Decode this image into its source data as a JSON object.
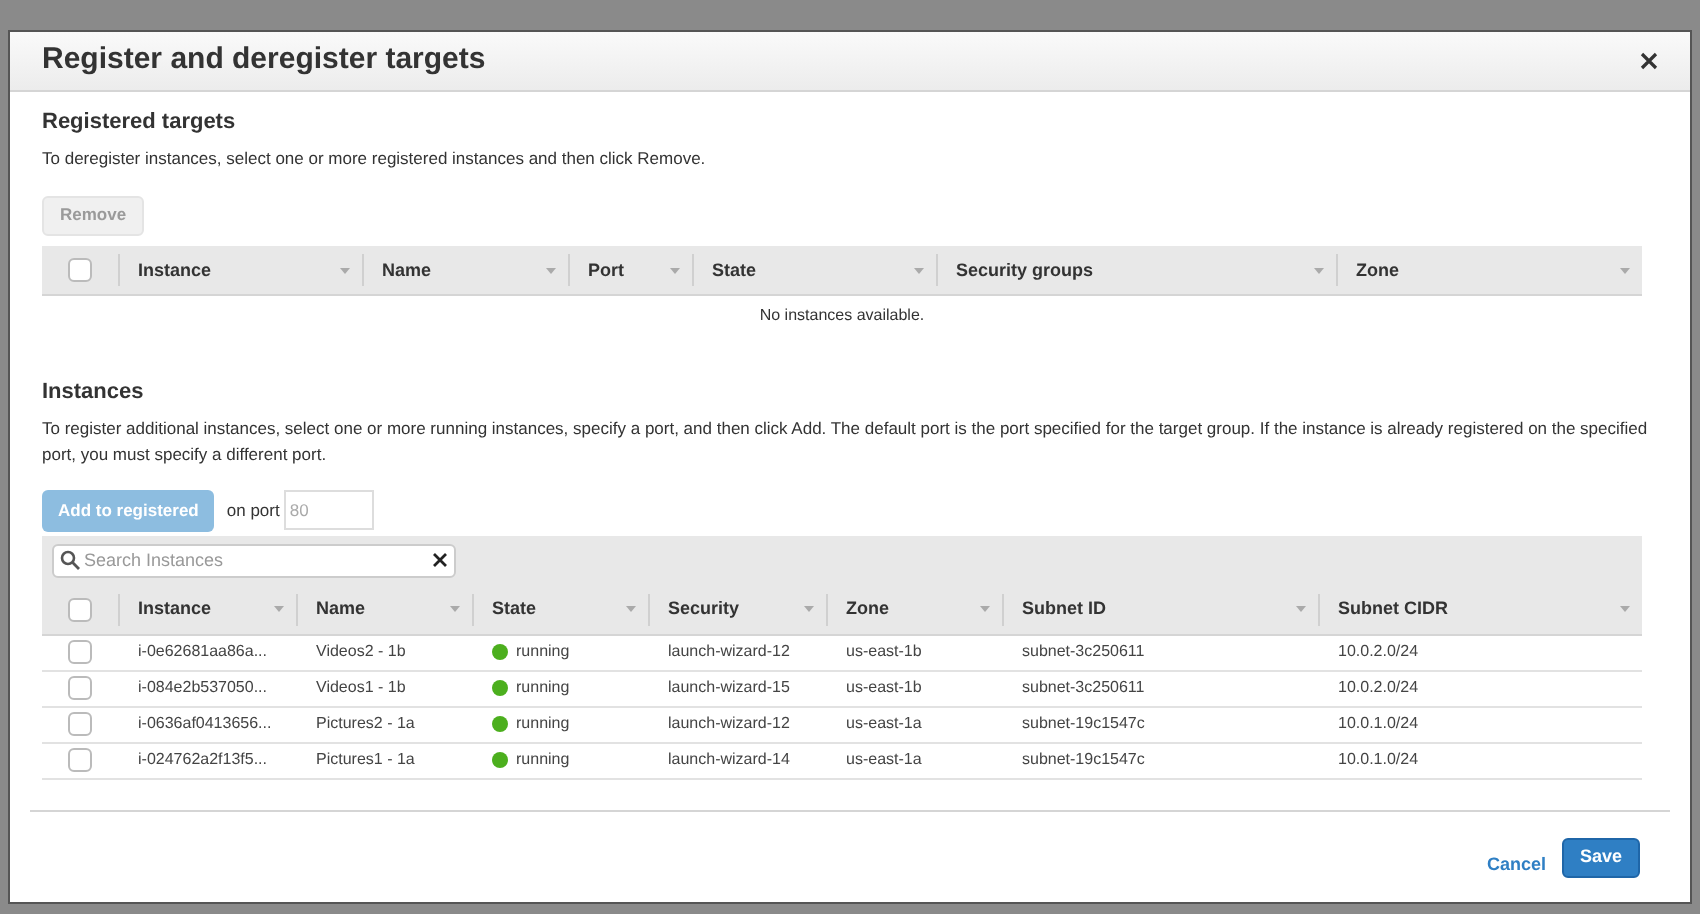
{
  "dialog": {
    "title": "Register and deregister targets"
  },
  "registered": {
    "heading": "Registered targets",
    "description": "To deregister instances, select one or more registered instances and then click Remove.",
    "remove_button": {
      "label": "Remove",
      "disabled": true
    },
    "select_all_checked": false,
    "columns": [
      "Instance",
      "Name",
      "Port",
      "State",
      "Security groups",
      "Zone"
    ],
    "empty_message": "No instances available."
  },
  "instances": {
    "heading": "Instances",
    "description": "To register additional instances, select one or more running instances, specify a port, and then click Add. The default port is the port specified for the target group. If the instance is already registered on the specified port, you must specify a different port.",
    "add_button": {
      "label": "Add to registered",
      "disabled": true
    },
    "port_label": "on port",
    "port_placeholder": "80",
    "search": {
      "placeholder": "Search Instances"
    },
    "select_all_checked": false,
    "columns": [
      "Instance",
      "Name",
      "State",
      "Security",
      "Zone",
      "Subnet ID",
      "Subnet CIDR"
    ],
    "rows": [
      {
        "checked": false,
        "instance": "i-0e62681aa86a...",
        "name": "Videos2 - 1b",
        "state": "running",
        "color": "#4caf1e",
        "security": "launch-wizard-12",
        "zone": "us-east-1b",
        "subnet_id": "subnet-3c250611",
        "subnet_cidr": "10.0.2.0/24"
      },
      {
        "checked": false,
        "instance": "i-084e2b537050...",
        "name": "Videos1 - 1b",
        "state": "running",
        "color": "#4caf1e",
        "security": "launch-wizard-15",
        "zone": "us-east-1b",
        "subnet_id": "subnet-3c250611",
        "subnet_cidr": "10.0.2.0/24"
      },
      {
        "checked": false,
        "instance": "i-0636af0413656...",
        "name": "Pictures2 - 1a",
        "state": "running",
        "color": "#4caf1e",
        "security": "launch-wizard-12",
        "zone": "us-east-1a",
        "subnet_id": "subnet-19c1547c",
        "subnet_cidr": "10.0.1.0/24"
      },
      {
        "checked": false,
        "instance": "i-024762a2f13f5...",
        "name": "Pictures1 - 1a",
        "state": "running",
        "color": "#4caf1e",
        "security": "launch-wizard-14",
        "zone": "us-east-1a",
        "subnet_id": "subnet-19c1547c",
        "subnet_cidr": "10.0.1.0/24"
      }
    ]
  },
  "footer": {
    "cancel": "Cancel",
    "save": "Save"
  }
}
